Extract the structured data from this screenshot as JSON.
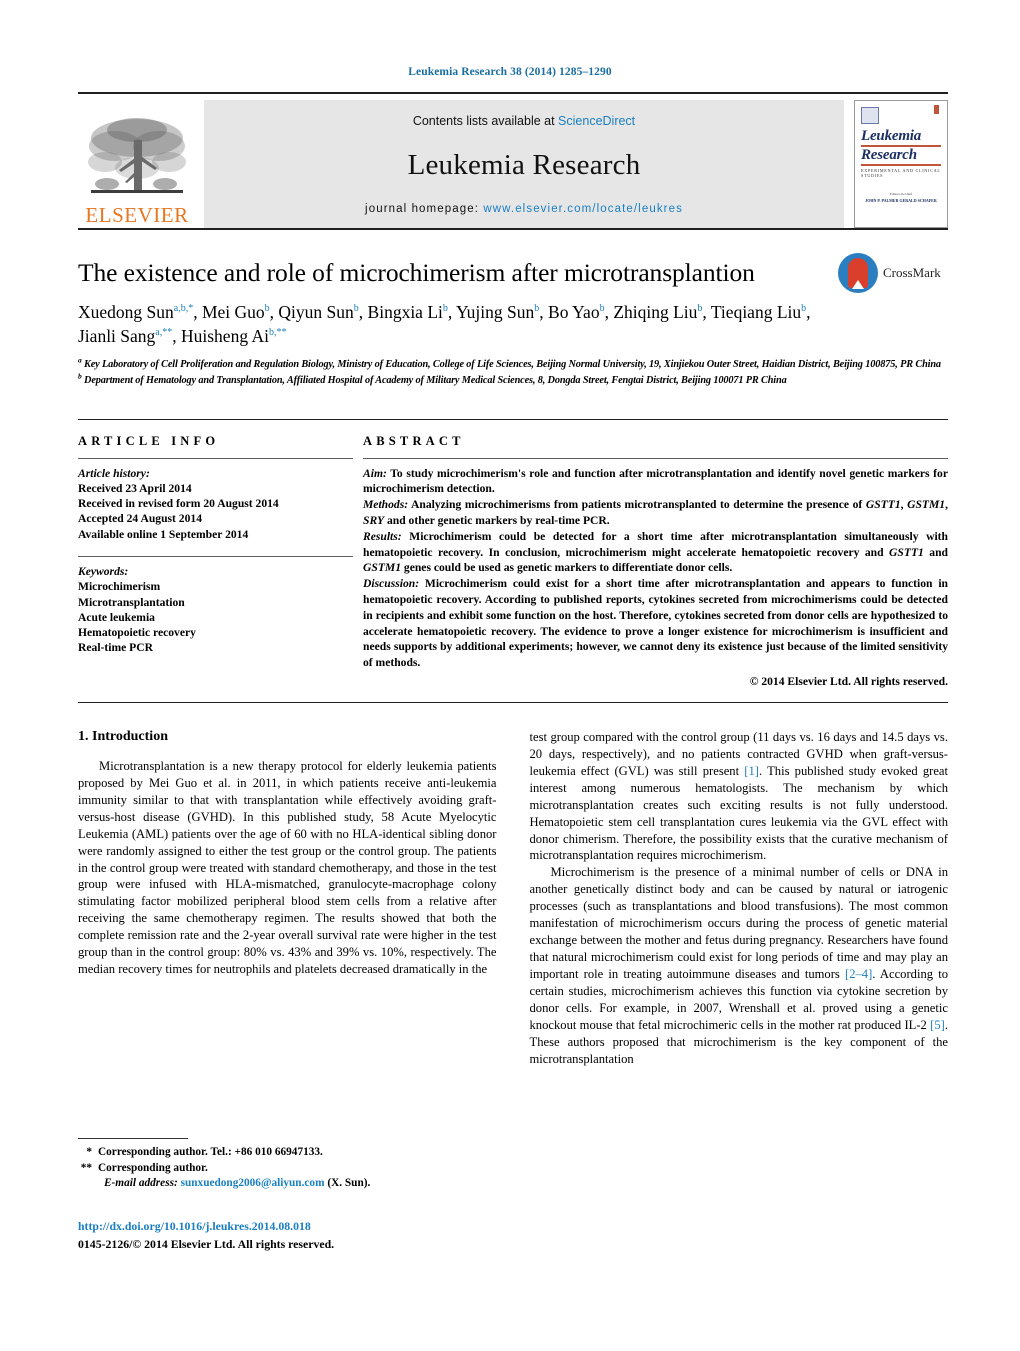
{
  "running_head": "Leukemia Research 38 (2014) 1285–1290",
  "header": {
    "contents_prefix": "Contents lists available at ",
    "sciencedirect": "ScienceDirect",
    "journal_name": "Leukemia Research",
    "homepage_prefix": "journal homepage: ",
    "homepage_url": "www.elsevier.com/locate/leukres",
    "publisher": "ELSEVIER",
    "cover": {
      "line1": "Leukemia",
      "line2": "Research",
      "subtitle": "Experimental and Clinical Studies",
      "meta1": "Editors-in-Chief",
      "meta2": "JOHN P. PALMER     GERALD SCHAFER"
    }
  },
  "article": {
    "title": "The existence and role of microchimerism after microtransplantion",
    "crossmark_label": "CrossMark",
    "authors": [
      {
        "name": "Xuedong Sun",
        "sup": "a,b,*"
      },
      {
        "name": "Mei Guo",
        "sup": "b"
      },
      {
        "name": "Qiyun Sun",
        "sup": "b"
      },
      {
        "name": "Bingxia Li",
        "sup": "b"
      },
      {
        "name": "Yujing Sun",
        "sup": "b"
      },
      {
        "name": "Bo Yao",
        "sup": "b"
      },
      {
        "name": "Zhiqing Liu",
        "sup": "b"
      },
      {
        "name": "Tieqiang Liu",
        "sup": "b"
      },
      {
        "name": "Jianli Sang",
        "sup": "a,**"
      },
      {
        "name": "Huisheng Ai",
        "sup": "b,**"
      }
    ],
    "affiliations": [
      {
        "mark": "a",
        "text": "Key Laboratory of Cell Proliferation and Regulation Biology, Ministry of Education, College of Life Sciences, Beijing Normal University, 19, Xinjiekou Outer Street, Haidian District, Beijing 100875, PR China"
      },
      {
        "mark": "b",
        "text": "Department of Hematology and Transplantation, Affiliated Hospital of Academy of Military Medical Sciences, 8, Dongda Street, Fengtai District, Beijing 100071 PR China"
      }
    ]
  },
  "info": {
    "heading": "ARTICLE INFO",
    "history_label": "Article history:",
    "history": [
      "Received 23 April 2014",
      "Received in revised form 20 August 2014",
      "Accepted 24 August 2014",
      "Available online 1 September 2014"
    ],
    "keywords_label": "Keywords:",
    "keywords": [
      "Microchimerism",
      "Microtransplantation",
      "Acute leukemia",
      "Hematopoietic recovery",
      "Real-time PCR"
    ]
  },
  "abstract": {
    "heading": "ABSTRACT",
    "sections": [
      {
        "label": "Aim:",
        "text": " To study microchimerism's role and function after microtransplantation and identify novel genetic markers for microchimerism detection."
      },
      {
        "label": "Methods:",
        "text": " Analyzing microchimerisms from patients microtransplanted to determine the presence of GSTT1, GSTM1, SRY and other genetic markers by real-time PCR."
      },
      {
        "label": "Results:",
        "text": " Microchimerism could be detected for a short time after microtransplantation simultaneously with hematopoietic recovery. In conclusion, microchimerism might accelerate hematopoietic recovery and GSTT1 and GSTM1 genes could be used as genetic markers to differentiate donor cells."
      },
      {
        "label": "Discussion:",
        "text": " Microchimerism could exist for a short time after microtransplantation and appears to function in hematopoietic recovery. According to published reports, cytokines secreted from microchimerisms could be detected in recipients and exhibit some function on the host. Therefore, cytokines secreted from donor cells are hypothesized to accelerate hematopoietic recovery. The evidence to prove a longer existence for microchimerism is insufficient and needs supports by additional experiments; however, we cannot deny its existence just because of the limited sensitivity of methods."
      }
    ],
    "copyright": "© 2014 Elsevier Ltd. All rights reserved."
  },
  "body": {
    "section_number_title": "1. Introduction",
    "left_paragraphs": [
      "Microtransplantation is a new therapy protocol for elderly leukemia patients proposed by Mei Guo et al. in 2011, in which patients receive anti-leukemia immunity similar to that with transplantation while effectively avoiding graft-versus-host disease (GVHD). In this published study, 58 Acute Myelocytic Leukemia (AML) patients over the age of 60 with no HLA-identical sibling donor were randomly assigned to either the test group or the control group. The patients in the control group were treated with standard chemotherapy, and those in the test group were infused with HLA-mismatched, granulocyte-macrophage colony stimulating factor mobilized peripheral blood stem cells from a relative after receiving the same chemotherapy regimen. The results showed that both the complete remission rate and the 2-year overall survival rate were higher in the test group than in the control group: 80% vs. 43% and 39% vs. 10%, respectively. The median recovery times for neutrophils and platelets decreased dramatically in the"
    ],
    "right_paragraph_1_part1": "test group compared with the control group (11 days vs. 16 days and 14.5 days vs. 20 days, respectively), and no patients contracted GVHD when graft-versus-leukemia effect (GVL) was still present ",
    "right_paragraph_1_ref": "[1]",
    "right_paragraph_1_part2": ". This published study evoked great interest among numerous hematologists. The mechanism by which microtransplantation creates such exciting results is not fully understood. Hematopoietic stem cell transplantation cures leukemia via the GVL effect with donor chimerism. Therefore, the possibility exists that the curative mechanism of microtransplantation requires microchimerism.",
    "right_paragraph_2_part1": "Microchimerism is the presence of a minimal number of cells or DNA in another genetically distinct body and can be caused by natural or iatrogenic processes (such as transplantations and blood transfusions). The most common manifestation of microchimerism occurs during the process of genetic material exchange between the mother and fetus during pregnancy. Researchers have found that natural microchimerism could exist for long periods of time and may play an important role in treating autoimmune diseases and tumors ",
    "right_paragraph_2_ref_a": "[2–4]",
    "right_paragraph_2_part2": ". According to certain studies, microchimerism achieves this function via cytokine secretion by donor cells. For example, in 2007, Wrenshall et al. proved using a genetic knockout mouse that fetal microchimeric cells in the mother rat produced IL-2 ",
    "right_paragraph_2_ref_b": "[5]",
    "right_paragraph_2_part3": ". These authors proposed that microchimerism is the key component of the microtransplantation"
  },
  "footnotes": {
    "items": [
      {
        "mark": "*",
        "text": "Corresponding author. Tel.: +86 010 66947133."
      },
      {
        "mark": "**",
        "text": "Corresponding author."
      }
    ],
    "email_label": "E-mail address:",
    "email": "sunxuedong2006@aliyun.com",
    "email_suffix": "(X. Sun)."
  },
  "doi": {
    "url": "http://dx.doi.org/10.1016/j.leukres.2014.08.018",
    "issn_line": "0145-2126/© 2014 Elsevier Ltd. All rights reserved."
  },
  "colors": {
    "link": "#1a7fc1",
    "running_head": "#1a6ea0",
    "elsevier_orange": "#e87722",
    "band_gray": "#e6e6e6",
    "crossmark_blue": "#2b7fc0",
    "crossmark_red": "#d93f2b"
  }
}
